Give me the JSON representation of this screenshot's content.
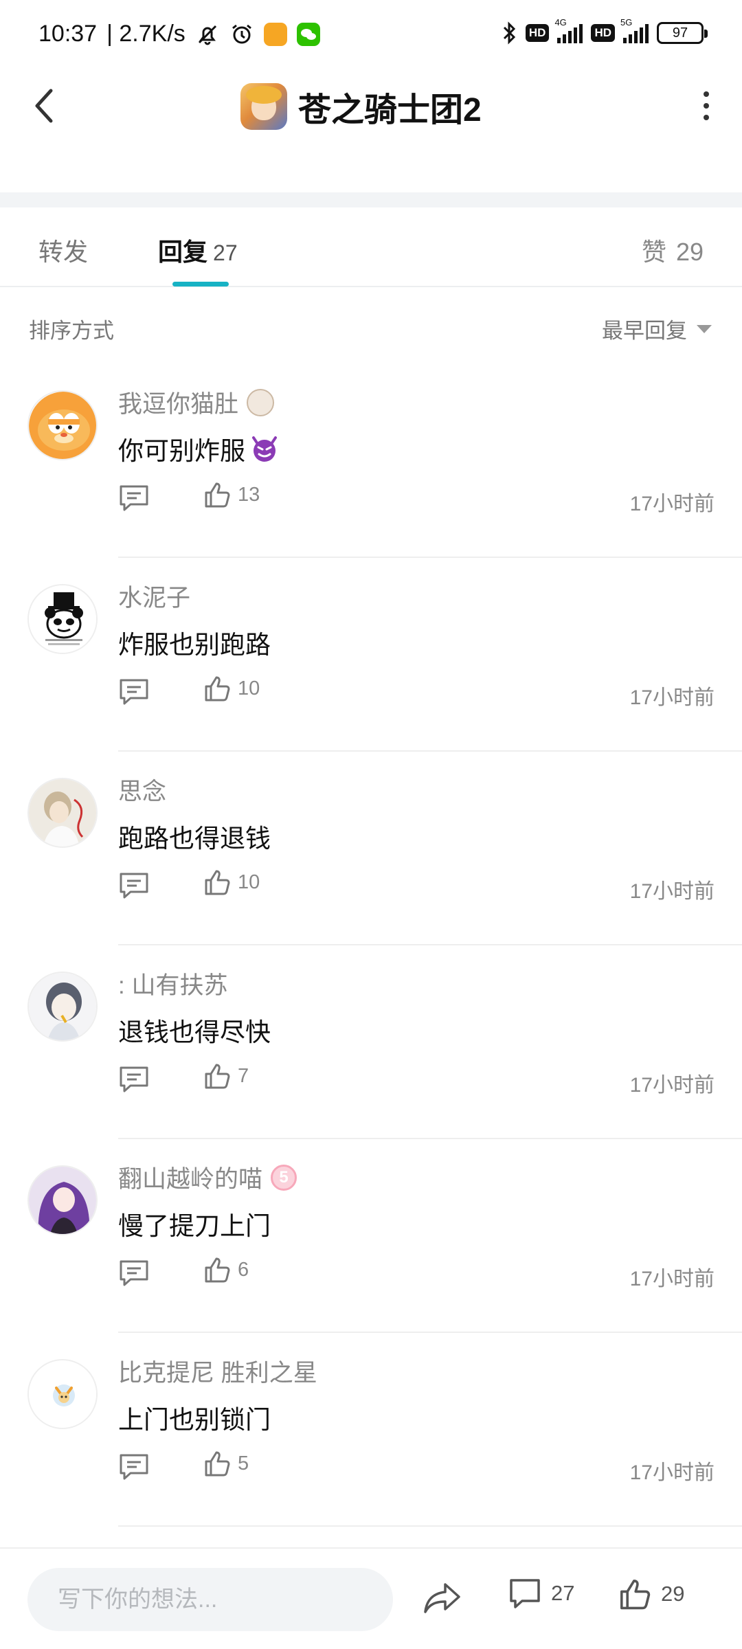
{
  "status_bar": {
    "time": "10:37",
    "network_speed": "| 2.7K/s",
    "hd_label": "HD",
    "net1": "4G",
    "net2": "5G",
    "battery": "97"
  },
  "header": {
    "title": "苍之骑士团2"
  },
  "tabs": [
    {
      "label": "转发",
      "count": ""
    },
    {
      "label": "回复",
      "count": "27"
    },
    {
      "label": "赞",
      "count": "29"
    }
  ],
  "sort": {
    "label": "排序方式",
    "selected": "最早回复"
  },
  "comments": [
    {
      "name": "我逗你猫肚",
      "text": "你可别炸服",
      "likes": "13",
      "time": "17小时前"
    },
    {
      "name": "水泥子",
      "text": "炸服也别跑路",
      "likes": "10",
      "time": "17小时前"
    },
    {
      "name": "思念",
      "text": "跑路也得退钱",
      "likes": "10",
      "time": "17小时前"
    },
    {
      "name": ":  山有扶苏",
      "text": "退钱也得尽快",
      "likes": "7",
      "time": "17小时前"
    },
    {
      "name": "翻山越岭的喵",
      "text": "慢了提刀上门",
      "likes": "6",
      "time": "17小时前",
      "level_badge": "5"
    },
    {
      "name": "比克提尼 胜利之星",
      "text": "上门也别锁门",
      "likes": "5",
      "time": "17小时前"
    }
  ],
  "bottom_bar": {
    "input_placeholder": "写下你的想法...",
    "comment_count": "27",
    "like_count": "29"
  },
  "colors": {
    "accent": "#17b2c4",
    "text_primary": "#111111",
    "text_secondary": "#888888",
    "separator": "#eeeeee",
    "input_bg": "#f2f4f6"
  }
}
